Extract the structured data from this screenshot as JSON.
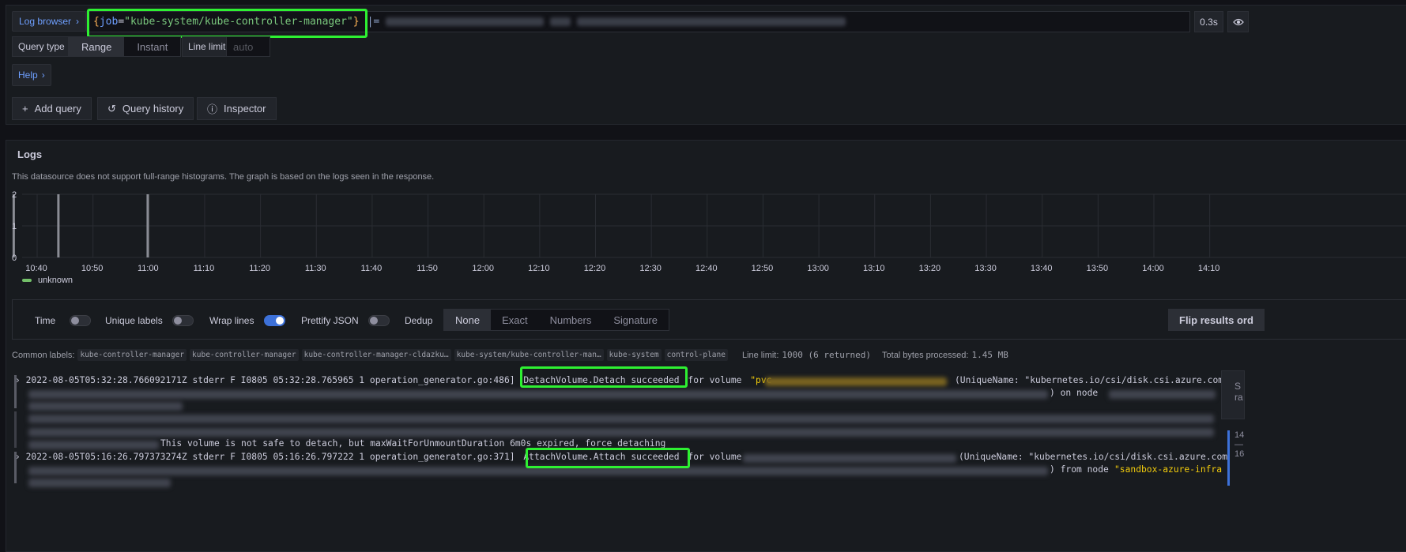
{
  "query": {
    "log_browser_label": "Log browser",
    "brace_open": "{",
    "key": "job",
    "eq": "=",
    "value": "\"kube-system/kube-controller-manager\"",
    "brace_close": "}",
    "pipe_op": "|=",
    "timing": "0.3s",
    "query_type_label": "Query type",
    "range_label": "Range",
    "instant_label": "Instant",
    "line_limit_label": "Line limit",
    "line_limit_placeholder": "auto",
    "help_label": "Help",
    "add_query_label": "Add query",
    "query_history_label": "Query history",
    "inspector_label": "Inspector"
  },
  "logs": {
    "title": "Logs",
    "histogram_note": "This datasource does not support full-range histograms. The graph is based on the logs seen in the response.",
    "legend_label": "unknown",
    "options": {
      "time": "Time",
      "unique_labels": "Unique labels",
      "wrap_lines": "Wrap lines",
      "prettify_json": "Prettify JSON",
      "dedup": "Dedup",
      "dedup_options": [
        "None",
        "Exact",
        "Numbers",
        "Signature"
      ],
      "flip_results": "Flip results ord"
    },
    "common_labels_title": "Common labels:",
    "common_labels": [
      "kube-controller-manager",
      "kube-controller-manager",
      "kube-controller-manager-cldazku…",
      "kube-system/kube-controller-man…",
      "kube-system",
      "control-plane"
    ],
    "line_limit_text": "Line limit:",
    "line_limit_value": "1000 (6 returned)",
    "bytes_text": "Total bytes processed:",
    "bytes_value": "1.45 MB",
    "rows": [
      {
        "prefix": "2022-08-05T05:32:28.766092171Z stderr F I0805 05:32:28.765965       1 operation_generator.go:486]",
        "highlight": "DetachVolume.Detach succeeded",
        "suffix": "for volume",
        "unique_name": "(UniqueName: \"kubernetes.io/csi/disk.csi.azure.com",
        "line2_tail": ") on node"
      },
      {
        "tail": "This volume is not safe to detach, but maxWaitForUnmountDuration 6m0s expired, force detaching"
      },
      {
        "prefix": "2022-08-05T05:16:26.797373274Z stderr F I0805 05:16:26.797222       1 operation_generator.go:371]",
        "highlight": "AttachVolume.Attach succeeded",
        "suffix": "for volume",
        "unique_name": "(UniqueName: \"kubernetes.io/csi/disk.csi.azure.com",
        "line2_tail": ") from node",
        "node_name": "\"sandbox-azure-infra"
      }
    ],
    "side_stub_1": "S ra",
    "side_stub_2": "14 — 16"
  },
  "chart_data": {
    "type": "bar",
    "x_ticks": [
      "10:40",
      "10:50",
      "11:00",
      "11:10",
      "11:20",
      "11:30",
      "11:40",
      "11:50",
      "12:00",
      "12:10",
      "12:20",
      "12:30",
      "12:40",
      "12:50",
      "13:00",
      "13:10",
      "13:20",
      "13:30",
      "13:40",
      "13:50",
      "14:00",
      "14:10"
    ],
    "y_ticks": [
      0,
      1,
      2
    ],
    "ylim": [
      0,
      2
    ],
    "series": [
      {
        "name": "unknown",
        "color": "#73bf69",
        "points": [
          {
            "x": "10:38",
            "value": 2
          },
          {
            "x": "10:46",
            "value": 2
          },
          {
            "x": "11:02",
            "value": 2
          }
        ]
      }
    ]
  }
}
